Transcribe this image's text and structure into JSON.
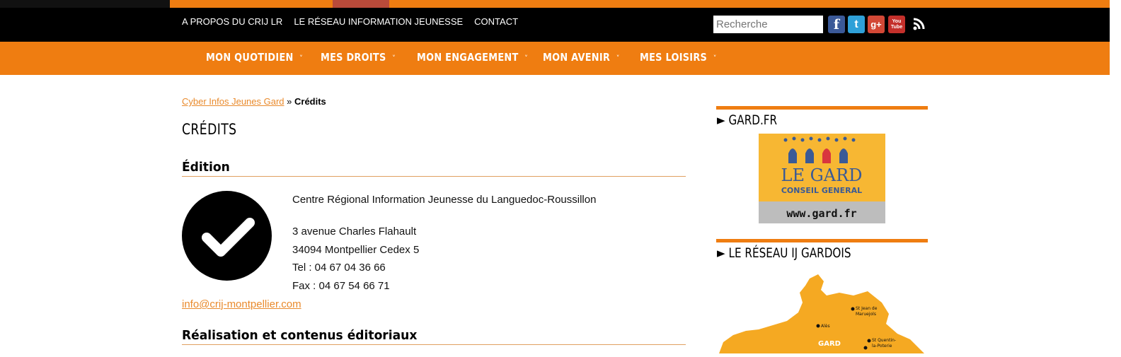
{
  "header": {
    "top_links": [
      "A PROPOS DU CRIJ LR",
      "LE RÉSEAU INFORMATION JEUNESSE",
      "CONTACT"
    ],
    "search_placeholder": "Recherche",
    "social": [
      {
        "name": "facebook-icon",
        "glyph": "f",
        "color": "#3b5998"
      },
      {
        "name": "twitter-icon",
        "glyph": "t",
        "color": "#2fa0d8"
      },
      {
        "name": "google-plus-icon",
        "glyph": "g+",
        "color": "#d34836"
      },
      {
        "name": "youtube-icon",
        "glyph": "You Tube",
        "color": "#c4302b"
      }
    ]
  },
  "nav": {
    "items": [
      "MON QUOTIDIEN",
      "MES DROITS",
      "MON ENGAGEMENT",
      "MON AVENIR",
      "MES LOISIRS"
    ],
    "chevron": "˅"
  },
  "breadcrumb": {
    "link": "Cyber Infos Jeunes Gard",
    "separator": " » ",
    "current": "Crédits"
  },
  "page_title": "CRÉDITS",
  "sections": {
    "edition": "Édition",
    "realisation": "Réalisation et contenus éditoriaux"
  },
  "contact": {
    "org": "Centre Régional Information Jeunesse du Languedoc-Roussillon",
    "address1": "3 avenue Charles Flahault",
    "address2": "34094 Montpellier Cedex 5",
    "tel": "Tel : 04 67 04 36 66",
    "fax": "Fax : 04 67 54 66 71",
    "email": "info@crij-montpellier.com"
  },
  "sidebar": {
    "gard_heading": "► GARD.FR",
    "gard_logo": {
      "line1": "LE GARD",
      "line2": "CONSEIL GENERAL",
      "url": "www.gard.fr"
    },
    "reseau_heading": "► LE RÉSEAU IJ GARDOIS",
    "map": {
      "labels": [
        "St Jean de",
        "Maruejols",
        "Alès",
        "St Quentin-",
        "la-Poterie",
        "GARD"
      ]
    }
  },
  "colors": {
    "brand_orange": "#ef7d11",
    "link_orange": "#e98a2c",
    "map_yellow": "#f5a922"
  }
}
